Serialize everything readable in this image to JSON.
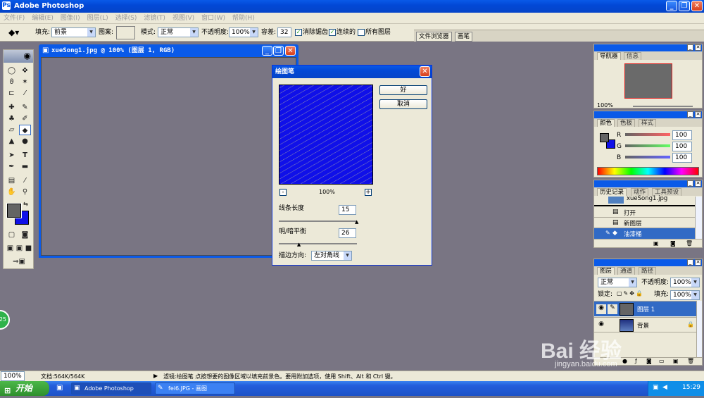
{
  "app": {
    "title": "Adobe Photoshop"
  },
  "menu": [
    "文件(F)",
    "编辑(E)",
    "图像(I)",
    "图层(L)",
    "选择(S)",
    "滤镜(T)",
    "视图(V)",
    "窗口(W)",
    "帮助(H)"
  ],
  "options": {
    "fill_label": "填充:",
    "fill_value": "前景",
    "pattern_label": "图案:",
    "mode_label": "模式:",
    "mode_value": "正常",
    "opacity_label": "不透明度:",
    "opacity_value": "100%",
    "tolerance_label": "容差:",
    "tolerance_value": "32",
    "antialias_label": "消除锯齿",
    "contiguous_label": "连续的",
    "all_layers_label": "所有图层",
    "palette_tabs": [
      "文件浏览器",
      "画笔"
    ]
  },
  "document": {
    "title": "xueSong1.jpg @ 100% (图层 1, RGB)"
  },
  "dialog": {
    "title": "绘图笔",
    "ok": "好",
    "cancel": "取消",
    "zoom": "100%",
    "stroke_length_label": "线条长度",
    "stroke_length": "15",
    "stroke_length_fraction": 1.0,
    "balance_label": "明/暗平衡",
    "balance": "26",
    "balance_fraction": 0.26,
    "direction_label": "描边方向:",
    "direction_value": "左对角线"
  },
  "navigator": {
    "tabs": [
      "导航器",
      "信息"
    ],
    "zoom": "100%"
  },
  "color": {
    "tabs": [
      "颜色",
      "色板",
      "样式"
    ],
    "r_label": "R",
    "g_label": "G",
    "b_label": "B",
    "r": "100",
    "g": "100",
    "b": "100"
  },
  "history": {
    "tabs": [
      "历史记录",
      "动作",
      "工具预设"
    ],
    "snapshot": "xueSong1.jpg",
    "items": [
      "打开",
      "新图层",
      "油漆桶"
    ]
  },
  "layers": {
    "tabs": [
      "图层",
      "通道",
      "路径"
    ],
    "blend_mode": "正常",
    "opacity_label": "不透明度:",
    "opacity": "100%",
    "lock_label": "锁定:",
    "fill_label": "填充:",
    "fill": "100%",
    "items": [
      "图层 1",
      "背景"
    ]
  },
  "status": {
    "zoom": "100%",
    "doc_info": "文档:564K/564K",
    "hint": "滤镜:绘图笔  点按想要的图像区域以填充前景色。要用附加选项，使用 Shift、Alt 和 Ctrl 键。"
  },
  "taskbar": {
    "start": "开始",
    "items": [
      "Adobe Photoshop",
      "fei6.JPG - 画图"
    ],
    "clock": "15:29"
  },
  "watermark": {
    "text": "Bai 经验",
    "url": "jingyan.baidu.com"
  },
  "badge": "25",
  "colors": {
    "canvas_blue": "#1010e8",
    "xp_blue": "#0a5ae8",
    "foreground": "#646464",
    "background_swatch": "#1010e8"
  }
}
